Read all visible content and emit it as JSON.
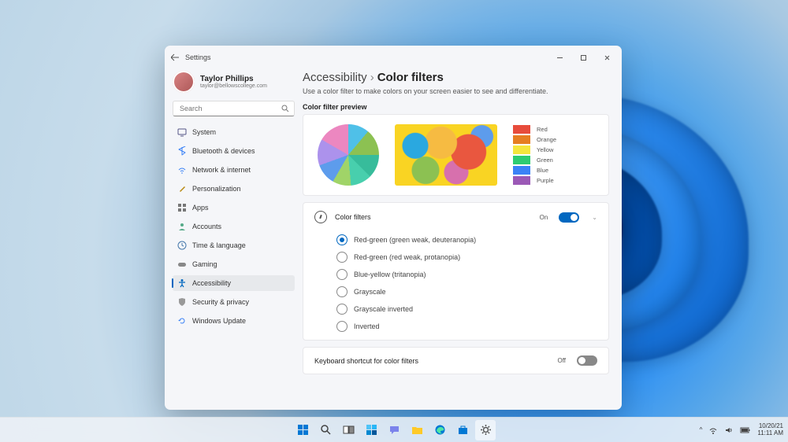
{
  "titlebar": {
    "app": "Settings"
  },
  "user": {
    "name": "Taylor Phillips",
    "email": "taylor@bellowscollege.com"
  },
  "search": {
    "placeholder": "Search"
  },
  "nav": {
    "items": [
      {
        "label": "System"
      },
      {
        "label": "Bluetooth & devices"
      },
      {
        "label": "Network & internet"
      },
      {
        "label": "Personalization"
      },
      {
        "label": "Apps"
      },
      {
        "label": "Accounts"
      },
      {
        "label": "Time & language"
      },
      {
        "label": "Gaming"
      },
      {
        "label": "Accessibility"
      },
      {
        "label": "Security & privacy"
      },
      {
        "label": "Windows Update"
      }
    ]
  },
  "page": {
    "crumb_parent": "Accessibility",
    "crumb_current": "Color filters",
    "description": "Use a color filter to make colors on your screen easier to see and differentiate.",
    "preview_title": "Color filter preview"
  },
  "swatches": [
    {
      "color": "#e74c3c",
      "name": "Red"
    },
    {
      "color": "#e67e22",
      "name": "Orange"
    },
    {
      "color": "#f5e63d",
      "name": "Yellow"
    },
    {
      "color": "#2ecc71",
      "name": "Green"
    },
    {
      "color": "#3b82f6",
      "name": "Blue"
    },
    {
      "color": "#9b59b6",
      "name": "Purple"
    }
  ],
  "filter_setting": {
    "label": "Color filters",
    "state": "On",
    "options": [
      {
        "label": "Red-green (green weak, deuteranopia)",
        "selected": true
      },
      {
        "label": "Red-green (red weak, protanopia)",
        "selected": false
      },
      {
        "label": "Blue-yellow (tritanopia)",
        "selected": false
      },
      {
        "label": "Grayscale",
        "selected": false
      },
      {
        "label": "Grayscale inverted",
        "selected": false
      },
      {
        "label": "Inverted",
        "selected": false
      }
    ]
  },
  "shortcut_setting": {
    "label": "Keyboard shortcut for color filters",
    "state": "Off"
  },
  "clock": {
    "date": "10/20/21",
    "time": "11:11 AM"
  }
}
